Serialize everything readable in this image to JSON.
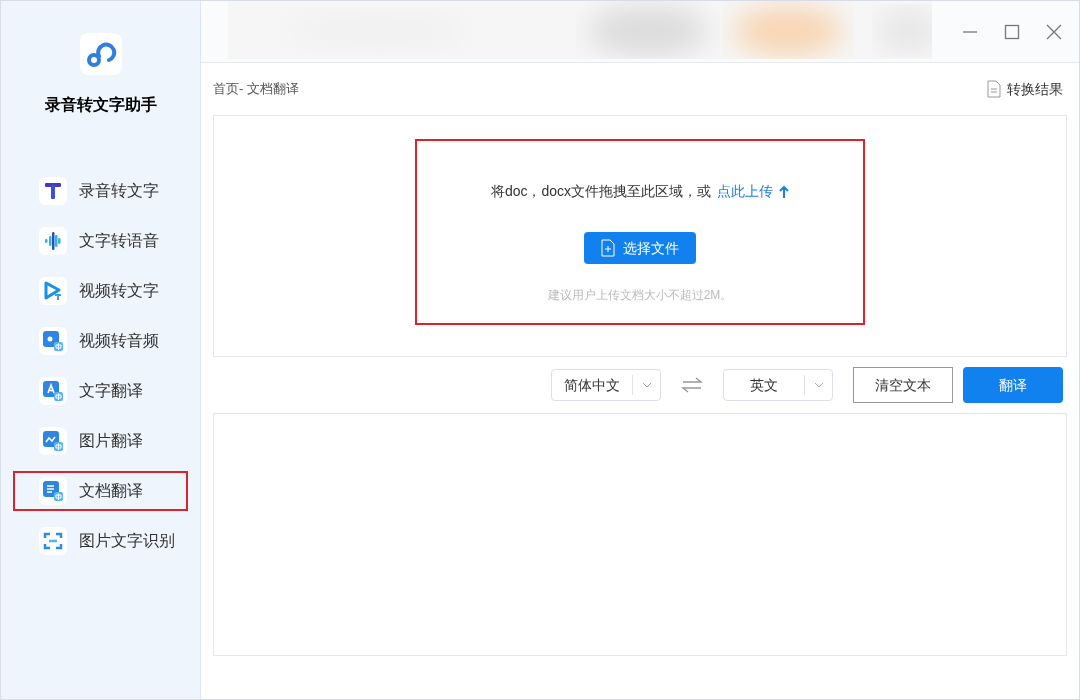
{
  "app": {
    "name": "录音转文字助手"
  },
  "sidebar": {
    "items": [
      {
        "label": "录音转文字",
        "kind": "t",
        "selected": false
      },
      {
        "label": "文字转语音",
        "kind": "wave",
        "selected": false
      },
      {
        "label": "视频转文字",
        "kind": "play",
        "selected": false
      },
      {
        "label": "视频转音频",
        "kind": "video",
        "selected": false
      },
      {
        "label": "文字翻译",
        "kind": "text",
        "selected": false
      },
      {
        "label": "图片翻译",
        "selected": false
      },
      {
        "label": "文档翻译",
        "kind": "doc",
        "selected": true
      },
      {
        "label": "图片文字识别",
        "kind": "scan",
        "selected": false
      }
    ]
  },
  "breadcrumb": "首页- 文档翻译",
  "result_button": "转换结果",
  "upload": {
    "highlighted": true,
    "prompt": "将doc，docx文件拖拽至此区域，或",
    "link": "点此上传",
    "button": "选择文件",
    "hint": "建议用户上传文档大小不超过2M。"
  },
  "source_language": "简体中文",
  "target_language": "英文",
  "clear_button": "清空文本",
  "translate_button": "翻译"
}
